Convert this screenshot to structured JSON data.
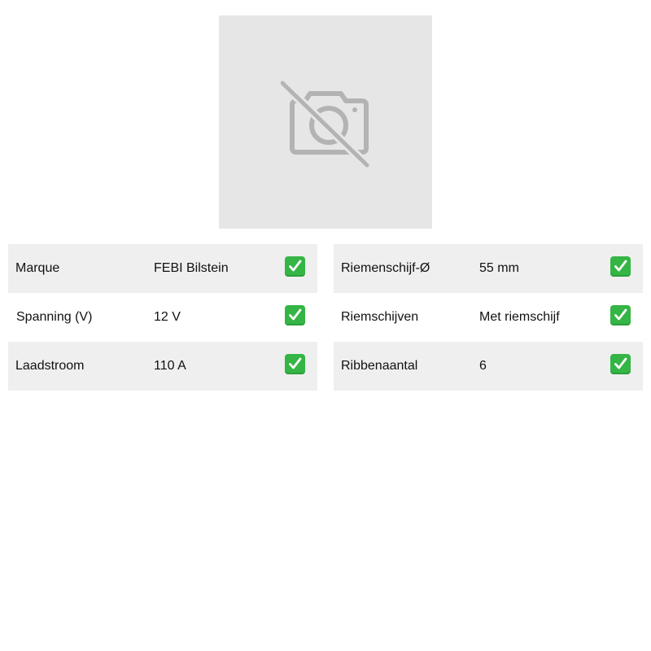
{
  "product_image": {
    "icon": "no-photo-icon",
    "background_color": "#e6e6e6"
  },
  "specs": {
    "left": [
      {
        "label": "Marque",
        "value": "FEBI Bilstein",
        "icon": "check-icon"
      },
      {
        "label": "Spanning (V)",
        "value": "12 V",
        "icon": "check-icon"
      },
      {
        "label": "Laadstroom",
        "value": "110 A",
        "icon": "check-icon"
      }
    ],
    "right": [
      {
        "label": "Riemenschijf-Ø",
        "value": "55 mm",
        "icon": "check-icon"
      },
      {
        "label": "Riemschijven",
        "value": "Met riemschijf",
        "icon": "check-icon"
      },
      {
        "label": "Ribbenaantal",
        "value": "6",
        "icon": "check-icon"
      }
    ]
  },
  "colors": {
    "row_shade": "#efefef",
    "check_green": "#34b545"
  }
}
